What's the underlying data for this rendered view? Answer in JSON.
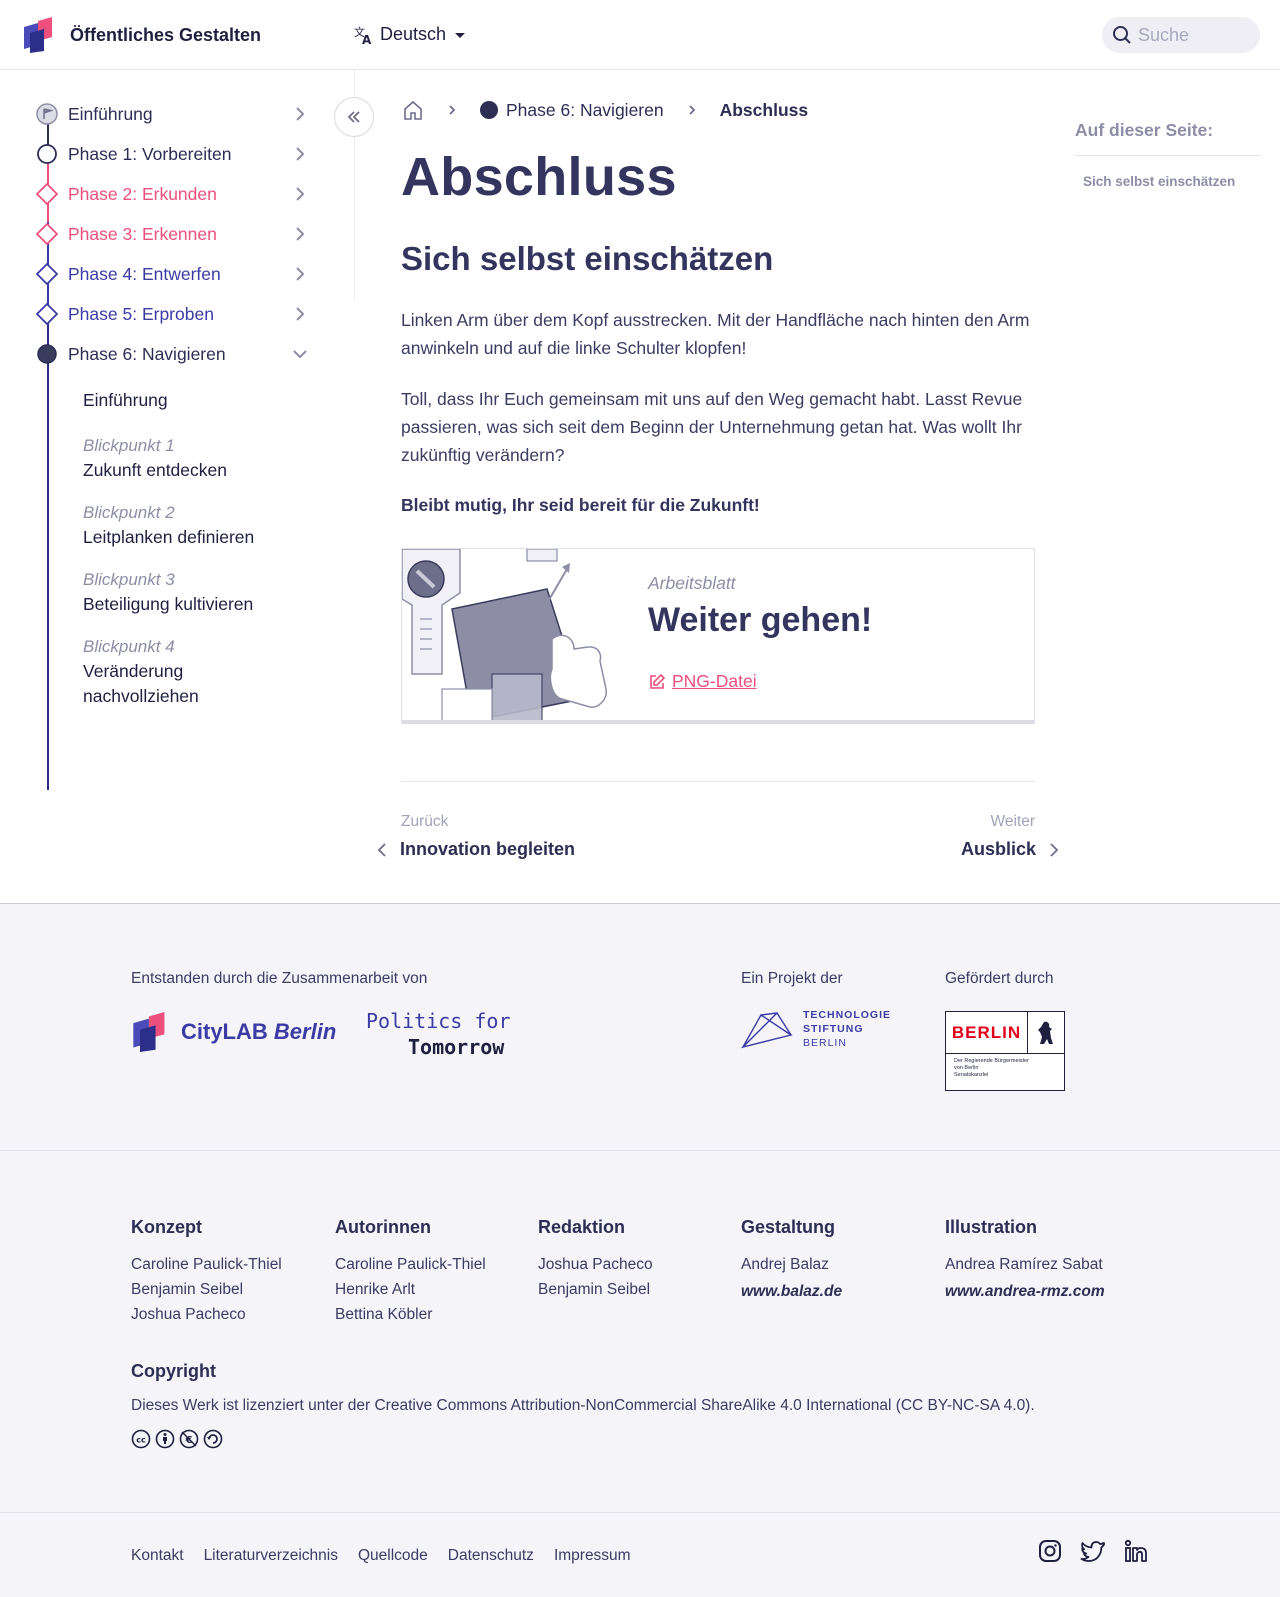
{
  "header": {
    "site_title": "Öffentliches Gestalten",
    "language": "Deutsch",
    "search_placeholder": "Suche"
  },
  "sidebar": {
    "phases": [
      {
        "label": "Einführung",
        "color": "#2c2e54"
      },
      {
        "label": "Phase 1: Vorbereiten",
        "color": "#2c2e54"
      },
      {
        "label": "Phase 2: Erkunden",
        "color": "#ee4f7d"
      },
      {
        "label": "Phase 3: Erkennen",
        "color": "#ee4f7d"
      },
      {
        "label": "Phase 4: Entwerfen",
        "color": "#3b3ba6"
      },
      {
        "label": "Phase 5: Erproben",
        "color": "#3b3ba6"
      },
      {
        "label": "Phase 6: Navigieren",
        "color": "#2c2e54"
      }
    ],
    "subitems": [
      {
        "kicker": "",
        "name": "Einführung"
      },
      {
        "kicker": "Blickpunkt 1",
        "name": "Zukunft entdecken"
      },
      {
        "kicker": "Blickpunkt 2",
        "name": "Leitplanken definieren"
      },
      {
        "kicker": "Blickpunkt 3",
        "name": "Beteiligung kultivieren"
      },
      {
        "kicker": "Blickpunkt 4",
        "name": "Veränderung nachvollziehen"
      }
    ]
  },
  "breadcrumb": {
    "phase": "Phase 6: Navigieren",
    "current": "Abschluss"
  },
  "main": {
    "title": "Abschluss",
    "section_title": "Sich selbst einschätzen",
    "paragraph_1": "Linken Arm über dem Kopf ausstrecken. Mit der Handfläche nach hinten den Arm anwinkeln und auf die linke Schulter klopfen!",
    "paragraph_2": "Toll, dass Ihr Euch gemeinsam mit uns auf den Weg gemacht habt. Lasst Revue passieren, was sich seit dem Beginn der Unternehmung getan hat. Was wollt Ihr zukünftig verändern?",
    "bold_line": "Bleibt mutig, Ihr seid bereit für die Zukunft!",
    "card": {
      "kicker": "Arbeitsblatt",
      "title": "Weiter gehen!",
      "link": "PNG-Datei"
    },
    "pager": {
      "prev_label": "Zurück",
      "prev_title": "Innovation begleiten",
      "next_label": "Weiter",
      "next_title": "Ausblick"
    }
  },
  "toc": {
    "title": "Auf dieser Seite:",
    "links": [
      "Sich selbst einschätzen"
    ]
  },
  "footer": {
    "collab_label": "Entstanden durch die Zusammenarbeit von",
    "citylab": "CityLAB",
    "citylab_city": "Berlin",
    "pft_line1": "Politics for",
    "pft_line2": "Tomorrow",
    "project_label": "Ein Projekt der",
    "tsb_line1": "TECHNOLOGIE",
    "tsb_line2": "STIFTUNG",
    "tsb_line3": "BERLIN",
    "funded_label": "Gefördert durch",
    "berlin_word": "BERLIN",
    "berlin_sub1": "Der Regierende Bürgermeister",
    "berlin_sub2": "von Berlin",
    "berlin_sub3": "Senatskanzlei",
    "credits": [
      {
        "title": "Konzept",
        "names": [
          "Caroline Paulick-Thiel",
          "Benjamin Seibel",
          "Joshua Pacheco"
        ],
        "site": ""
      },
      {
        "title": "Autorinnen",
        "names": [
          "Caroline Paulick-Thiel",
          "Henrike Arlt",
          "Bettina Köbler"
        ],
        "site": ""
      },
      {
        "title": "Redaktion",
        "names": [
          "Joshua Pacheco",
          "Benjamin Seibel"
        ],
        "site": ""
      },
      {
        "title": "Gestaltung",
        "names": [
          "Andrej Balaz"
        ],
        "site": "www.balaz.de"
      },
      {
        "title": "Illustration",
        "names": [
          "Andrea Ramírez Sabat"
        ],
        "site": "www.andrea-rmz.com"
      }
    ],
    "copyright_title": "Copyright",
    "copyright_text": "Dieses Werk ist lizenziert unter der Creative Commons Attribution-NonCommercial ShareAlike 4.0 International (CC BY-NC-SA 4.0).",
    "links": [
      "Kontakt",
      "Literaturverzeichnis",
      "Quellcode",
      "Datenschutz",
      "Impressum"
    ]
  }
}
